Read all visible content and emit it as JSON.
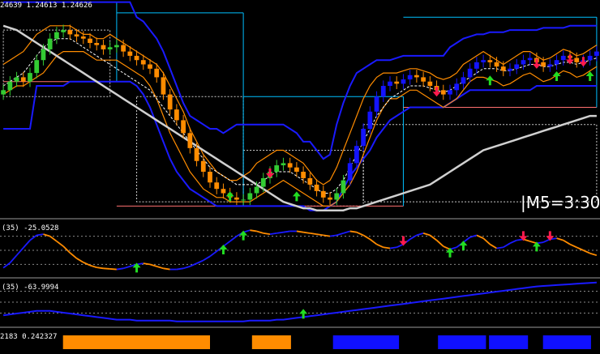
{
  "chart_data": [
    {
      "type": "candlestick",
      "panel": "main",
      "header_text": "24639 1.24613 1.24626",
      "timer_text": "|M5=3:30",
      "colors": {
        "bull": "#33cc33",
        "bear": "#ff8c00",
        "blue_bull": "#1414ff",
        "band_outer": "#1a1aff",
        "band_inner": "#ff8c00",
        "ma_long": "#d0d0d0",
        "channel": "#00bfff",
        "box": "#ffffff",
        "box_red": "#ff7070"
      },
      "close": [
        0.58,
        0.62,
        0.64,
        0.62,
        0.66,
        0.72,
        0.77,
        0.82,
        0.85,
        0.86,
        0.84,
        0.83,
        0.82,
        0.8,
        0.79,
        0.77,
        0.78,
        0.79,
        0.76,
        0.74,
        0.72,
        0.7,
        0.68,
        0.64,
        0.56,
        0.49,
        0.44,
        0.38,
        0.31,
        0.25,
        0.2,
        0.15,
        0.12,
        0.1,
        0.08,
        0.07,
        0.07,
        0.1,
        0.13,
        0.17,
        0.2,
        0.23,
        0.24,
        0.22,
        0.2,
        0.17,
        0.14,
        0.11,
        0.08,
        0.07,
        0.1,
        0.16,
        0.24,
        0.32,
        0.4,
        0.48,
        0.55,
        0.6,
        0.62,
        0.61,
        0.63,
        0.65,
        0.64,
        0.62,
        0.6,
        0.58,
        0.56,
        0.58,
        0.61,
        0.64,
        0.68,
        0.71,
        0.72,
        0.71,
        0.69,
        0.67,
        0.68,
        0.7,
        0.72,
        0.73,
        0.71,
        0.69,
        0.7,
        0.72,
        0.74,
        0.73,
        0.71,
        0.72,
        0.74,
        0.76
      ],
      "series": [
        {
          "name": "",
          "type": "band_upper",
          "values": [
            0.99,
            0.99,
            0.99,
            0.99,
            0.99,
            0.99,
            0.99,
            0.99,
            0.99,
            0.99,
            0.99,
            0.99,
            0.99,
            0.99,
            0.99,
            0.99,
            0.99,
            0.99,
            0.99,
            0.99,
            0.92,
            0.9,
            0.86,
            0.82,
            0.76,
            0.68,
            0.6,
            0.52,
            0.46,
            0.44,
            0.42,
            0.4,
            0.4,
            0.38,
            0.4,
            0.42,
            0.42,
            0.42,
            0.42,
            0.42,
            0.42,
            0.42,
            0.42,
            0.4,
            0.38,
            0.34,
            0.34,
            0.3,
            0.26,
            0.28,
            0.42,
            0.52,
            0.6,
            0.66,
            0.68,
            0.7,
            0.72,
            0.72,
            0.72,
            0.73,
            0.74,
            0.74,
            0.74,
            0.74,
            0.74,
            0.74,
            0.74,
            0.78,
            0.8,
            0.82,
            0.83,
            0.84,
            0.84,
            0.85,
            0.85,
            0.85,
            0.86,
            0.86,
            0.86,
            0.86,
            0.86,
            0.87,
            0.87,
            0.87,
            0.87,
            0.88,
            0.88,
            0.88,
            0.88,
            0.88
          ]
        },
        {
          "name": "",
          "type": "band_lower",
          "values": [
            0.4,
            0.4,
            0.4,
            0.4,
            0.4,
            0.6,
            0.6,
            0.6,
            0.6,
            0.6,
            0.62,
            0.62,
            0.62,
            0.62,
            0.62,
            0.62,
            0.62,
            0.62,
            0.62,
            0.62,
            0.6,
            0.56,
            0.5,
            0.42,
            0.34,
            0.26,
            0.2,
            0.16,
            0.12,
            0.1,
            0.08,
            0.06,
            0.04,
            0.04,
            0.04,
            0.04,
            0.04,
            0.04,
            0.04,
            0.04,
            0.04,
            0.04,
            0.04,
            0.04,
            0.04,
            0.04,
            0.02,
            0.02,
            0.02,
            0.04,
            0.06,
            0.12,
            0.18,
            0.22,
            0.26,
            0.3,
            0.36,
            0.4,
            0.44,
            0.46,
            0.48,
            0.5,
            0.5,
            0.5,
            0.5,
            0.5,
            0.5,
            0.52,
            0.54,
            0.56,
            0.58,
            0.58,
            0.58,
            0.58,
            0.58,
            0.58,
            0.58,
            0.58,
            0.58,
            0.58,
            0.6,
            0.6,
            0.6,
            0.6,
            0.6,
            0.6,
            0.6,
            0.6,
            0.6,
            0.6
          ]
        },
        {
          "name": "",
          "type": "inner_upper",
          "values": [
            0.7,
            0.72,
            0.74,
            0.76,
            0.8,
            0.84,
            0.86,
            0.88,
            0.88,
            0.88,
            0.88,
            0.86,
            0.84,
            0.84,
            0.82,
            0.82,
            0.84,
            0.82,
            0.8,
            0.78,
            0.76,
            0.74,
            0.72,
            0.7,
            0.66,
            0.6,
            0.54,
            0.48,
            0.4,
            0.34,
            0.28,
            0.24,
            0.2,
            0.18,
            0.16,
            0.16,
            0.18,
            0.2,
            0.24,
            0.26,
            0.28,
            0.3,
            0.3,
            0.28,
            0.26,
            0.24,
            0.2,
            0.16,
            0.14,
            0.16,
            0.22,
            0.3,
            0.38,
            0.46,
            0.54,
            0.6,
            0.64,
            0.66,
            0.66,
            0.66,
            0.67,
            0.68,
            0.68,
            0.67,
            0.66,
            0.64,
            0.63,
            0.64,
            0.66,
            0.7,
            0.72,
            0.74,
            0.76,
            0.74,
            0.72,
            0.7,
            0.72,
            0.74,
            0.76,
            0.76,
            0.74,
            0.72,
            0.73,
            0.75,
            0.77,
            0.76,
            0.74,
            0.75,
            0.77,
            0.79
          ]
        },
        {
          "name": "",
          "type": "inner_lower",
          "values": [
            0.56,
            0.58,
            0.6,
            0.6,
            0.62,
            0.64,
            0.66,
            0.7,
            0.74,
            0.76,
            0.76,
            0.76,
            0.76,
            0.74,
            0.72,
            0.72,
            0.72,
            0.72,
            0.7,
            0.68,
            0.66,
            0.64,
            0.6,
            0.54,
            0.46,
            0.38,
            0.32,
            0.26,
            0.2,
            0.16,
            0.12,
            0.1,
            0.08,
            0.08,
            0.06,
            0.06,
            0.06,
            0.06,
            0.08,
            0.1,
            0.12,
            0.14,
            0.16,
            0.14,
            0.12,
            0.1,
            0.08,
            0.06,
            0.04,
            0.04,
            0.06,
            0.1,
            0.14,
            0.2,
            0.28,
            0.36,
            0.44,
            0.5,
            0.54,
            0.54,
            0.56,
            0.58,
            0.58,
            0.56,
            0.54,
            0.52,
            0.5,
            0.52,
            0.54,
            0.58,
            0.62,
            0.64,
            0.64,
            0.63,
            0.62,
            0.6,
            0.61,
            0.63,
            0.65,
            0.66,
            0.64,
            0.62,
            0.63,
            0.65,
            0.67,
            0.66,
            0.64,
            0.65,
            0.67,
            0.69
          ]
        },
        {
          "name": "",
          "type": "ma_long",
          "values": [
            0.88,
            0.87,
            0.86,
            0.84,
            0.82,
            0.8,
            0.78,
            0.76,
            0.74,
            0.72,
            0.7,
            0.68,
            0.66,
            0.64,
            0.62,
            0.6,
            0.58,
            0.56,
            0.54,
            0.52,
            0.5,
            0.48,
            0.46,
            0.44,
            0.42,
            0.4,
            0.38,
            0.36,
            0.34,
            0.32,
            0.3,
            0.28,
            0.26,
            0.24,
            0.22,
            0.2,
            0.18,
            0.16,
            0.14,
            0.12,
            0.1,
            0.08,
            0.06,
            0.05,
            0.04,
            0.03,
            0.03,
            0.02,
            0.02,
            0.02,
            0.02,
            0.02,
            0.03,
            0.03,
            0.04,
            0.05,
            0.06,
            0.07,
            0.08,
            0.09,
            0.1,
            0.11,
            0.12,
            0.13,
            0.14,
            0.16,
            0.18,
            0.2,
            0.22,
            0.24,
            0.26,
            0.28,
            0.3,
            0.31,
            0.32,
            0.33,
            0.34,
            0.35,
            0.36,
            0.37,
            0.38,
            0.39,
            0.4,
            0.41,
            0.42,
            0.43,
            0.44,
            0.45,
            0.46,
            0.46
          ]
        },
        {
          "name": "",
          "type": "ma_mid",
          "values": [
            0.6,
            0.62,
            0.64,
            0.66,
            0.7,
            0.74,
            0.78,
            0.8,
            0.82,
            0.82,
            0.82,
            0.8,
            0.78,
            0.76,
            0.74,
            0.72,
            0.7,
            0.68,
            0.66,
            0.64,
            0.62,
            0.6,
            0.58,
            0.54,
            0.5,
            0.46,
            0.42,
            0.38,
            0.34,
            0.3,
            0.26,
            0.22,
            0.2,
            0.18,
            0.16,
            0.14,
            0.14,
            0.14,
            0.14,
            0.16,
            0.18,
            0.2,
            0.2,
            0.2,
            0.18,
            0.16,
            0.14,
            0.12,
            0.1,
            0.1,
            0.12,
            0.16,
            0.22,
            0.28,
            0.34,
            0.4,
            0.46,
            0.5,
            0.54,
            0.56,
            0.58,
            0.6,
            0.6,
            0.6,
            0.59,
            0.58,
            0.57,
            0.58,
            0.6,
            0.62,
            0.64,
            0.66,
            0.68,
            0.68,
            0.68,
            0.67,
            0.67,
            0.68,
            0.69,
            0.7,
            0.7,
            0.69,
            0.69,
            0.7,
            0.71,
            0.71,
            0.7,
            0.71,
            0.72,
            0.73
          ]
        }
      ],
      "channels": [
        {
          "from": 0,
          "to": 17,
          "high": 0.99,
          "low": 0.62
        },
        {
          "from": 17,
          "to": 36,
          "high": 0.94,
          "low": 0.04
        },
        {
          "from": 36,
          "to": 60,
          "high": 0.55,
          "low": 0.04
        },
        {
          "from": 60,
          "to": 89,
          "high": 0.92,
          "low": 0.5
        }
      ],
      "boxes": [
        {
          "from": 0,
          "to": 16,
          "high": 0.86,
          "low": 0.55
        },
        {
          "from": 20,
          "to": 36,
          "high": 0.55,
          "low": 0.06
        },
        {
          "from": 36,
          "to": 54,
          "high": 0.3,
          "low": 0.04
        },
        {
          "from": 54,
          "to": 89,
          "high": 0.42,
          "low": 0.06
        }
      ],
      "arrows_up": [
        34,
        44,
        73,
        83,
        88
      ],
      "arrows_down": [
        40,
        65,
        80,
        85,
        87
      ]
    },
    {
      "type": "line",
      "panel": "oscillator",
      "header_text": "(35) -25.0528",
      "levels": [
        0.78,
        0.5,
        0.22
      ],
      "series": [
        {
          "name": "",
          "values": [
            0.15,
            0.25,
            0.4,
            0.55,
            0.7,
            0.8,
            0.82,
            0.78,
            0.68,
            0.58,
            0.45,
            0.34,
            0.26,
            0.2,
            0.16,
            0.14,
            0.13,
            0.12,
            0.14,
            0.18,
            0.22,
            0.24,
            0.22,
            0.18,
            0.14,
            0.12,
            0.12,
            0.14,
            0.18,
            0.24,
            0.3,
            0.38,
            0.48,
            0.58,
            0.68,
            0.78,
            0.86,
            0.9,
            0.88,
            0.84,
            0.82,
            0.84,
            0.86,
            0.88,
            0.88,
            0.86,
            0.84,
            0.82,
            0.8,
            0.78,
            0.8,
            0.84,
            0.88,
            0.86,
            0.8,
            0.72,
            0.62,
            0.56,
            0.54,
            0.56,
            0.62,
            0.72,
            0.8,
            0.84,
            0.8,
            0.7,
            0.58,
            0.52,
            0.56,
            0.66,
            0.76,
            0.8,
            0.74,
            0.62,
            0.54,
            0.56,
            0.64,
            0.7,
            0.72,
            0.68,
            0.64,
            0.66,
            0.72,
            0.74,
            0.7,
            0.62,
            0.56,
            0.5,
            0.44,
            0.4
          ]
        }
      ],
      "arrows_up": [
        20,
        33,
        36,
        67,
        69,
        80
      ],
      "arrows_down": [
        60,
        78,
        82
      ]
    },
    {
      "type": "line",
      "panel": "trend",
      "header_text": "(35) -63.9994",
      "levels": [
        0.75,
        0.5,
        0.25
      ],
      "series": [
        {
          "name": "",
          "values": [
            0.2,
            0.22,
            0.24,
            0.26,
            0.28,
            0.3,
            0.3,
            0.3,
            0.28,
            0.26,
            0.24,
            0.22,
            0.2,
            0.18,
            0.16,
            0.14,
            0.12,
            0.1,
            0.1,
            0.1,
            0.08,
            0.08,
            0.08,
            0.08,
            0.08,
            0.08,
            0.06,
            0.06,
            0.06,
            0.06,
            0.06,
            0.06,
            0.06,
            0.06,
            0.06,
            0.06,
            0.06,
            0.08,
            0.08,
            0.08,
            0.08,
            0.1,
            0.1,
            0.12,
            0.14,
            0.16,
            0.18,
            0.2,
            0.22,
            0.24,
            0.26,
            0.28,
            0.3,
            0.32,
            0.34,
            0.36,
            0.38,
            0.4,
            0.42,
            0.44,
            0.46,
            0.48,
            0.5,
            0.52,
            0.54,
            0.56,
            0.58,
            0.6,
            0.62,
            0.64,
            0.66,
            0.68,
            0.7,
            0.72,
            0.74,
            0.76,
            0.78,
            0.8,
            0.82,
            0.84,
            0.86,
            0.87,
            0.88,
            0.89,
            0.9,
            0.91,
            0.92,
            0.93,
            0.94,
            0.95
          ]
        }
      ],
      "arrows_up": [
        45
      ]
    },
    {
      "type": "heatmap",
      "panel": "signal",
      "header_text": "2183 0.242327",
      "blocks": [
        {
          "from": 0.105,
          "to": 0.35,
          "color": "#ff8c00"
        },
        {
          "from": 0.42,
          "to": 0.485,
          "color": "#ff8c00"
        },
        {
          "from": 0.555,
          "to": 0.665,
          "color": "#1010ff"
        },
        {
          "from": 0.73,
          "to": 0.81,
          "color": "#1010ff"
        },
        {
          "from": 0.815,
          "to": 0.88,
          "color": "#1010ff"
        },
        {
          "from": 0.905,
          "to": 0.985,
          "color": "#1010ff"
        }
      ]
    }
  ]
}
